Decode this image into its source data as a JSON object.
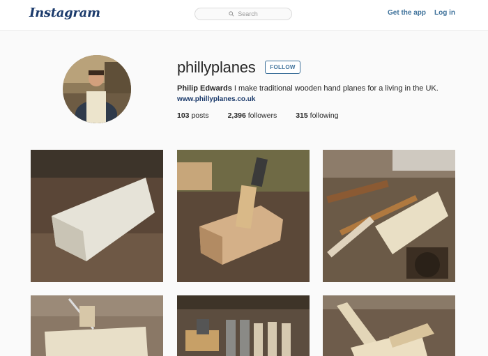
{
  "header": {
    "logo_text": "Instagram",
    "search_placeholder": "Search",
    "get_app_label": "Get the app",
    "login_label": "Log in"
  },
  "profile": {
    "username": "phillyplanes",
    "follow_label": "FOLLOW",
    "full_name": "Philip Edwards",
    "bio": "I make traditional wooden hand planes for a living in the UK.",
    "website": "www.phillyplanes.co.uk",
    "stats": [
      {
        "count": "103",
        "label": "posts"
      },
      {
        "count": "2,396",
        "label": "followers"
      },
      {
        "count": "315",
        "label": "following"
      }
    ]
  },
  "posts": [
    {
      "subject": "wooden-block-on-bench"
    },
    {
      "subject": "wooden-hand-plane"
    },
    {
      "subject": "chisels-on-bench"
    },
    {
      "subject": "plane-with-ruler"
    },
    {
      "subject": "plane-irons-set"
    },
    {
      "subject": "wooden-wedges"
    }
  ],
  "colors": {
    "accent": "#3f729b",
    "logo": "#1b3a6b",
    "background": "#fafafa"
  }
}
